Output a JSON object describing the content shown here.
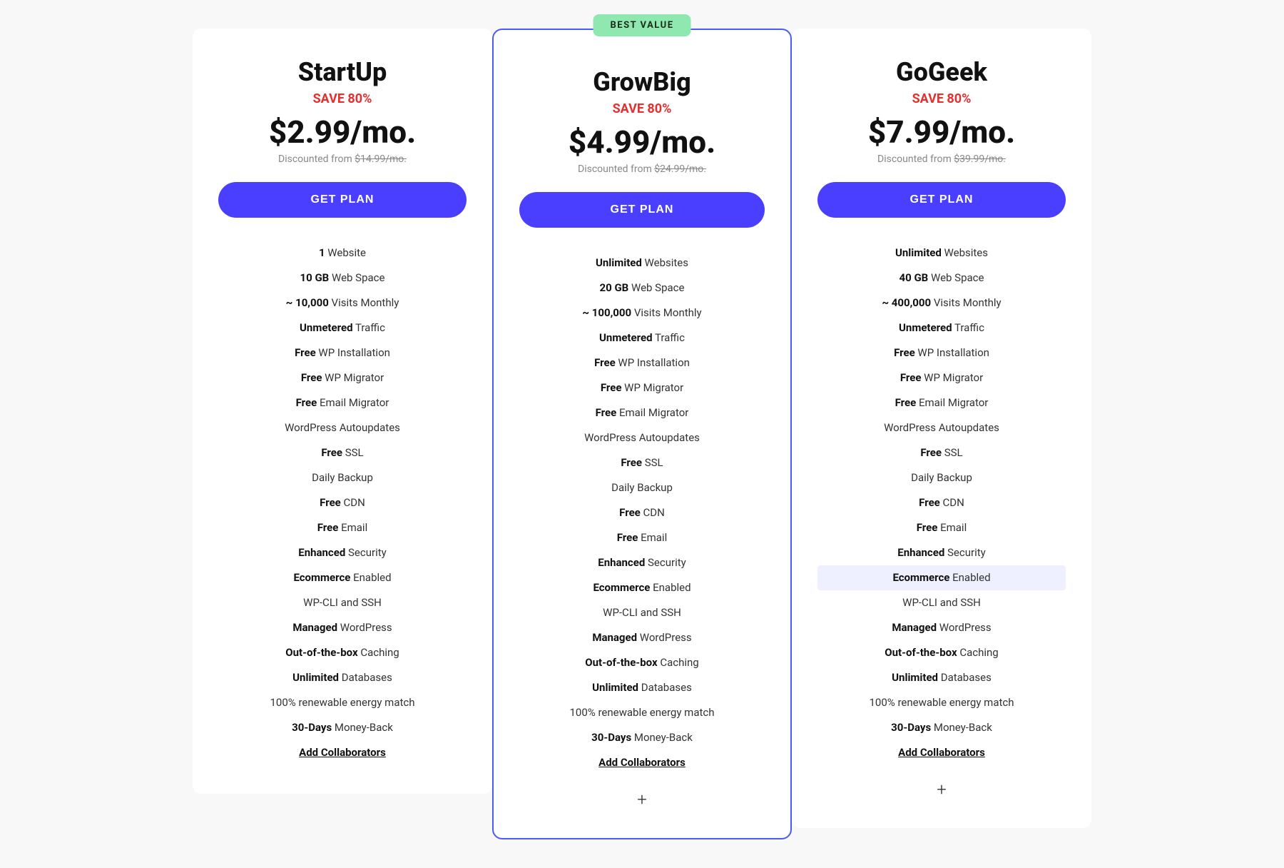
{
  "plans": [
    {
      "id": "startup",
      "name": "StartUp",
      "save": "SAVE 80%",
      "price": "$2.99/mo.",
      "discounted_from": "$14.99/mo.",
      "btn_label": "GET PLAN",
      "featured": false,
      "features": [
        {
          "bold": "1",
          "text": " Website"
        },
        {
          "bold": "10 GB",
          "text": " Web Space"
        },
        {
          "bold": "~ 10,000",
          "text": " Visits Monthly"
        },
        {
          "bold": "Unmetered",
          "text": " Traffic"
        },
        {
          "bold": "Free",
          "text": " WP Installation"
        },
        {
          "bold": "Free",
          "text": " WP Migrator"
        },
        {
          "bold": "Free",
          "text": " Email Migrator"
        },
        {
          "bold": "",
          "text": "WordPress Autoupdates"
        },
        {
          "bold": "Free",
          "text": " SSL"
        },
        {
          "bold": "",
          "text": "Daily Backup"
        },
        {
          "bold": "Free",
          "text": " CDN"
        },
        {
          "bold": "Free",
          "text": " Email"
        },
        {
          "bold": "Enhanced",
          "text": " Security"
        },
        {
          "bold": "Ecommerce",
          "text": " Enabled"
        },
        {
          "bold": "",
          "text": "WP-CLI and SSH"
        },
        {
          "bold": "Managed",
          "text": " WordPress"
        },
        {
          "bold": "Out-of-the-box",
          "text": " Caching"
        },
        {
          "bold": "Unlimited",
          "text": " Databases"
        },
        {
          "bold": "",
          "text": "100% renewable energy match"
        },
        {
          "bold": "30-Days",
          "text": " Money-Back"
        },
        {
          "bold": "Add Collaborators",
          "text": "",
          "underline": true
        }
      ],
      "show_plus": false
    },
    {
      "id": "growbig",
      "name": "GrowBig",
      "save": "SAVE 80%",
      "price": "$4.99/mo.",
      "discounted_from": "$24.99/mo.",
      "btn_label": "GET PLAN",
      "featured": true,
      "best_value_label": "BEST VALUE",
      "features": [
        {
          "bold": "Unlimited",
          "text": " Websites"
        },
        {
          "bold": "20 GB",
          "text": " Web Space"
        },
        {
          "bold": "~ 100,000",
          "text": " Visits Monthly"
        },
        {
          "bold": "Unmetered",
          "text": " Traffic"
        },
        {
          "bold": "Free",
          "text": " WP Installation"
        },
        {
          "bold": "Free",
          "text": " WP Migrator"
        },
        {
          "bold": "Free",
          "text": " Email Migrator"
        },
        {
          "bold": "",
          "text": "WordPress Autoupdates"
        },
        {
          "bold": "Free",
          "text": " SSL"
        },
        {
          "bold": "",
          "text": "Daily Backup"
        },
        {
          "bold": "Free",
          "text": " CDN"
        },
        {
          "bold": "Free",
          "text": " Email"
        },
        {
          "bold": "Enhanced",
          "text": " Security"
        },
        {
          "bold": "Ecommerce",
          "text": " Enabled"
        },
        {
          "bold": "",
          "text": "WP-CLI and SSH"
        },
        {
          "bold": "Managed",
          "text": " WordPress"
        },
        {
          "bold": "Out-of-the-box",
          "text": " Caching"
        },
        {
          "bold": "Unlimited",
          "text": " Databases"
        },
        {
          "bold": "",
          "text": "100% renewable energy match"
        },
        {
          "bold": "30-Days",
          "text": " Money-Back"
        },
        {
          "bold": "Add Collaborators",
          "text": "",
          "underline": true
        }
      ],
      "show_plus": true
    },
    {
      "id": "gogeek",
      "name": "GoGeek",
      "save": "SAVE 80%",
      "price": "$7.99/mo.",
      "discounted_from": "$39.99/mo.",
      "btn_label": "GET PLAN",
      "featured": false,
      "features": [
        {
          "bold": "Unlimited",
          "text": " Websites"
        },
        {
          "bold": "40 GB",
          "text": " Web Space"
        },
        {
          "bold": "~ 400,000",
          "text": " Visits Monthly"
        },
        {
          "bold": "Unmetered",
          "text": " Traffic"
        },
        {
          "bold": "Free",
          "text": " WP Installation"
        },
        {
          "bold": "Free",
          "text": " WP Migrator"
        },
        {
          "bold": "Free",
          "text": " Email Migrator"
        },
        {
          "bold": "",
          "text": "WordPress Autoupdates"
        },
        {
          "bold": "Free",
          "text": " SSL"
        },
        {
          "bold": "",
          "text": "Daily Backup"
        },
        {
          "bold": "Free",
          "text": " CDN"
        },
        {
          "bold": "Free",
          "text": " Email"
        },
        {
          "bold": "Enhanced",
          "text": " Security"
        },
        {
          "bold": "Ecommerce",
          "text": " Enabled",
          "highlight": true
        },
        {
          "bold": "",
          "text": "WP-CLI and SSH"
        },
        {
          "bold": "Managed",
          "text": " WordPress"
        },
        {
          "bold": "Out-of-the-box",
          "text": " Caching"
        },
        {
          "bold": "Unlimited",
          "text": " Databases"
        },
        {
          "bold": "",
          "text": "100% renewable energy match"
        },
        {
          "bold": "30-Days",
          "text": " Money-Back"
        },
        {
          "bold": "Add Collaborators",
          "text": "",
          "underline": true
        }
      ],
      "show_plus": true
    }
  ]
}
